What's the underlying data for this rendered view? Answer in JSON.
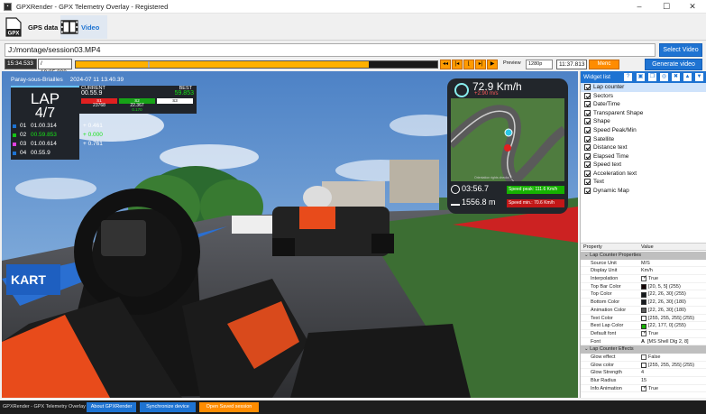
{
  "window": {
    "title": "GPXRender - GPX Telemetry Overlay - Registered",
    "app_icon": "gpx-app-icon"
  },
  "tabs": [
    {
      "label": "GPS data",
      "icon_text": "GPX",
      "icon": "gpx-icon"
    },
    {
      "label": "Video",
      "icon": "film-strip-icon"
    }
  ],
  "path": {
    "value": "J:/montage/session03.MP4",
    "select_label": "Select Video"
  },
  "timeline": {
    "current": "15:34.533",
    "total": "/ 19:05.000",
    "position_fraction": 0.81,
    "preview_label": "Preview",
    "resolution": "1280p",
    "clock": "11:37.813",
    "mode_label": "Menc",
    "generate_label": "Generate video"
  },
  "overlay": {
    "location": "Paray-sous-Briailles",
    "datetime": "2024-07 11 13.40.39",
    "lap_label": "LAP",
    "lap_count": "4/7",
    "current_label": "CURRENT",
    "current_time": "00.55.9",
    "best_label": "BEST",
    "best_time": "59.853",
    "sectors": [
      {
        "name": "S1",
        "value": "23768",
        "color": "#e02020"
      },
      {
        "name": "S2",
        "value": "22.367",
        "delta": "0.170",
        "color": "#17a317"
      },
      {
        "name": "S3",
        "value": "",
        "color": "#ffffff"
      }
    ],
    "laps": [
      {
        "num": "01",
        "time": "01.00.314",
        "delta": "+ 0.461",
        "color": "#1e73d2"
      },
      {
        "num": "02",
        "time": "00.59.853",
        "delta": "+ 0.000",
        "color": "#17c417"
      },
      {
        "num": "03",
        "time": "01.00.614",
        "delta": "+ 0.761",
        "color": "#e040e0"
      },
      {
        "num": "04",
        "time": "00.55.9",
        "delta": "",
        "color": "#1e73d2"
      }
    ],
    "speed": "72.9 Km/h",
    "speed_delta": "+2.90 m/s",
    "elapsed": "03:56.7",
    "distance": "1556.8 m",
    "speed_peak": "Speed peak: 111.6 Km/h",
    "speed_min": "Speed min.: 70.6 Km/h",
    "map_caption": "Orientation rights checks"
  },
  "widget_list": {
    "title": "Widget list",
    "help_icon": "?",
    "items": [
      "Lap counter",
      "Sectors",
      "Date/Time",
      "Transparent Shape",
      "Shape",
      "Speed Peak/Min",
      "Satellite",
      "Distance text",
      "Elapsed Time",
      "Speed text",
      "Acceleration text",
      "Text",
      "Dynamic Map"
    ]
  },
  "properties": {
    "col_property": "Property",
    "col_value": "Value",
    "sections": [
      {
        "title": "Lap Counter Properties",
        "rows": [
          {
            "name": "Source Unit",
            "value": "M/S"
          },
          {
            "name": "Display Unit",
            "value": "Km/h"
          },
          {
            "name": "Interpolation",
            "value": "True",
            "check": true
          },
          {
            "name": "Top Bar Color",
            "value": "[20, 5, 5] (255)",
            "swatch": "#140505"
          },
          {
            "name": "Top Color",
            "value": "[22, 26, 30] (255)",
            "swatch": "#161a1e"
          },
          {
            "name": "Bottom Color",
            "value": "[22, 26, 30] (180)",
            "swatch": "#161a1e"
          },
          {
            "name": "Animation Color",
            "value": "[22, 26, 30] (180)",
            "swatch": "#5c5c5c"
          },
          {
            "name": "Text Color",
            "value": "[255, 255, 255] (255)",
            "swatch": "#ffffff"
          },
          {
            "name": "Best Lap Color",
            "value": "[22, 177, 0] (255)",
            "swatch": "#16b100"
          },
          {
            "name": "Default font",
            "value": "True",
            "check": true
          },
          {
            "name": "Font",
            "value": "[MS Shell Dlg 2, 8]",
            "font_glyph": "A"
          }
        ]
      },
      {
        "title": "Lap Counter Effects",
        "rows": [
          {
            "name": "Glow effect",
            "value": "False",
            "check": false
          },
          {
            "name": "Glow color",
            "value": "[255, 255, 255] (255)",
            "swatch": "#ffffff"
          },
          {
            "name": "Glow Strength",
            "value": "4"
          },
          {
            "name": "Blur Radius",
            "value": "15"
          },
          {
            "name": "Info Animation",
            "value": "True",
            "check": true
          }
        ]
      }
    ]
  },
  "statusbar": {
    "title": "GPXRender - GPX Telemetry Overlay",
    "about": "About GPXRender",
    "sync": "Synchronize device",
    "open": "Open Saved session"
  },
  "colors": {
    "accent": "#1e73d2",
    "timeline_orange": "#ff9a00",
    "best_green": "#16b100"
  }
}
